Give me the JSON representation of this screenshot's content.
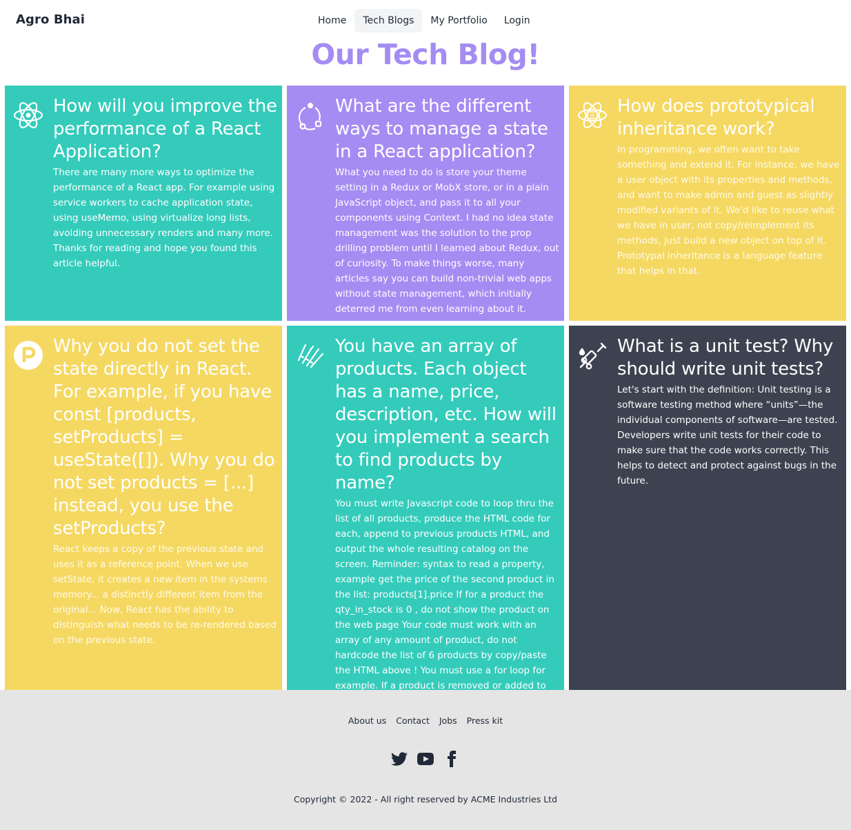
{
  "navbar": {
    "brand": "Agro Bhai",
    "items": [
      "Home",
      "Tech Blogs",
      "My Portfolio",
      "Login"
    ],
    "active": "Tech Blogs"
  },
  "page_title": "Our Tech Blog!",
  "cards": [
    {
      "title": "How will you improve the performance of a React Application?",
      "body": "There are many more ways to optimize the performance of a React app. For example using service workers to cache application state, using useMemo, using virtualize long lists, avoiding unnecessary renders and many more. Thanks for reading and hope you found this article helpful.",
      "icon": "react-atom-icon",
      "color": "#34cbbb"
    },
    {
      "title": "What are the different ways to manage a state in a React application?",
      "body": "What you need to do is store your theme setting in a Redux or MobX store, or in a plain JavaScript object, and pass it to all your components using Context. I had no idea state management was the solution to the prop drilling problem until I learned about Redux, out of curiosity. To make things worse, many articles say you can build non-trivial web apps without state management, which initially deterred me from even learning about it.",
      "icon": "state-cycle-icon",
      "color": "#a48cf2"
    },
    {
      "title": "How does prototypical inheritance work?",
      "body": "In programming, we often want to take something and extend it. For instance, we have a user object with its properties and methods, and want to make admin and guest as slightly modified variants of it. We'd like to reuse what we have in user, not copy/reimplement its methods, just build a new object on top of it. Prototypal inheritance is a language feature that helps in that.",
      "icon": "js-atom-icon",
      "color": "#f5d862"
    },
    {
      "title": "Why you do not set the state directly in React. For example, if you have const [products, setProducts] = useState([]). Why you do not set products = [...] instead, you use the setProducts?",
      "body": "React keeps a copy of the previous state and uses it as a reference point. When we use setState, it creates a new item in the systems memory... a distinctly different item from the original... Now, React has the ability to distinguish what needs to be re-rendered based on the previous state.",
      "icon": "p-circle-icon",
      "color": "#f5d862"
    },
    {
      "title": "You have an array of products. Each object has a name, price, description, etc. How will you implement a search to find products by name?",
      "body": "You must write Javascript code to loop thru the list of all products, produce the HTML code for each, append to previous products HTML, and output the whole resulting catalog on the screen. Reminder: syntax to read a property, example get the price of the second product in the list: products[1].price If for a product the qty_in_stock is 0 , do not show the product on the web page Your code must work with an array of any amount of product, do not hardcode the list of 6 products by copy/paste the HTML above ! You must use a for loop for example. If a product is removed or added to the list, the code doesn't need to be modified.",
      "icon": "search-brush-icon",
      "color": "#34cbbb"
    },
    {
      "title": "What is a unit test? Why should write unit tests?",
      "body": "Let's start with the definition: Unit testing is a software testing method where “units”—the individual components of software—are tested. Developers write unit tests for their code to make sure that the code works correctly. This helps to detect and protect against bugs in the future.",
      "icon": "syringe-test-icon",
      "color": "#3d4250"
    }
  ],
  "footer": {
    "links": [
      "About us",
      "Contact",
      "Jobs",
      "Press kit"
    ],
    "social_icons": [
      "twitter-icon",
      "youtube-icon",
      "facebook-icon"
    ],
    "copyright": "Copyright © 2022 - All right reserved by ACME Industries Ltd"
  }
}
